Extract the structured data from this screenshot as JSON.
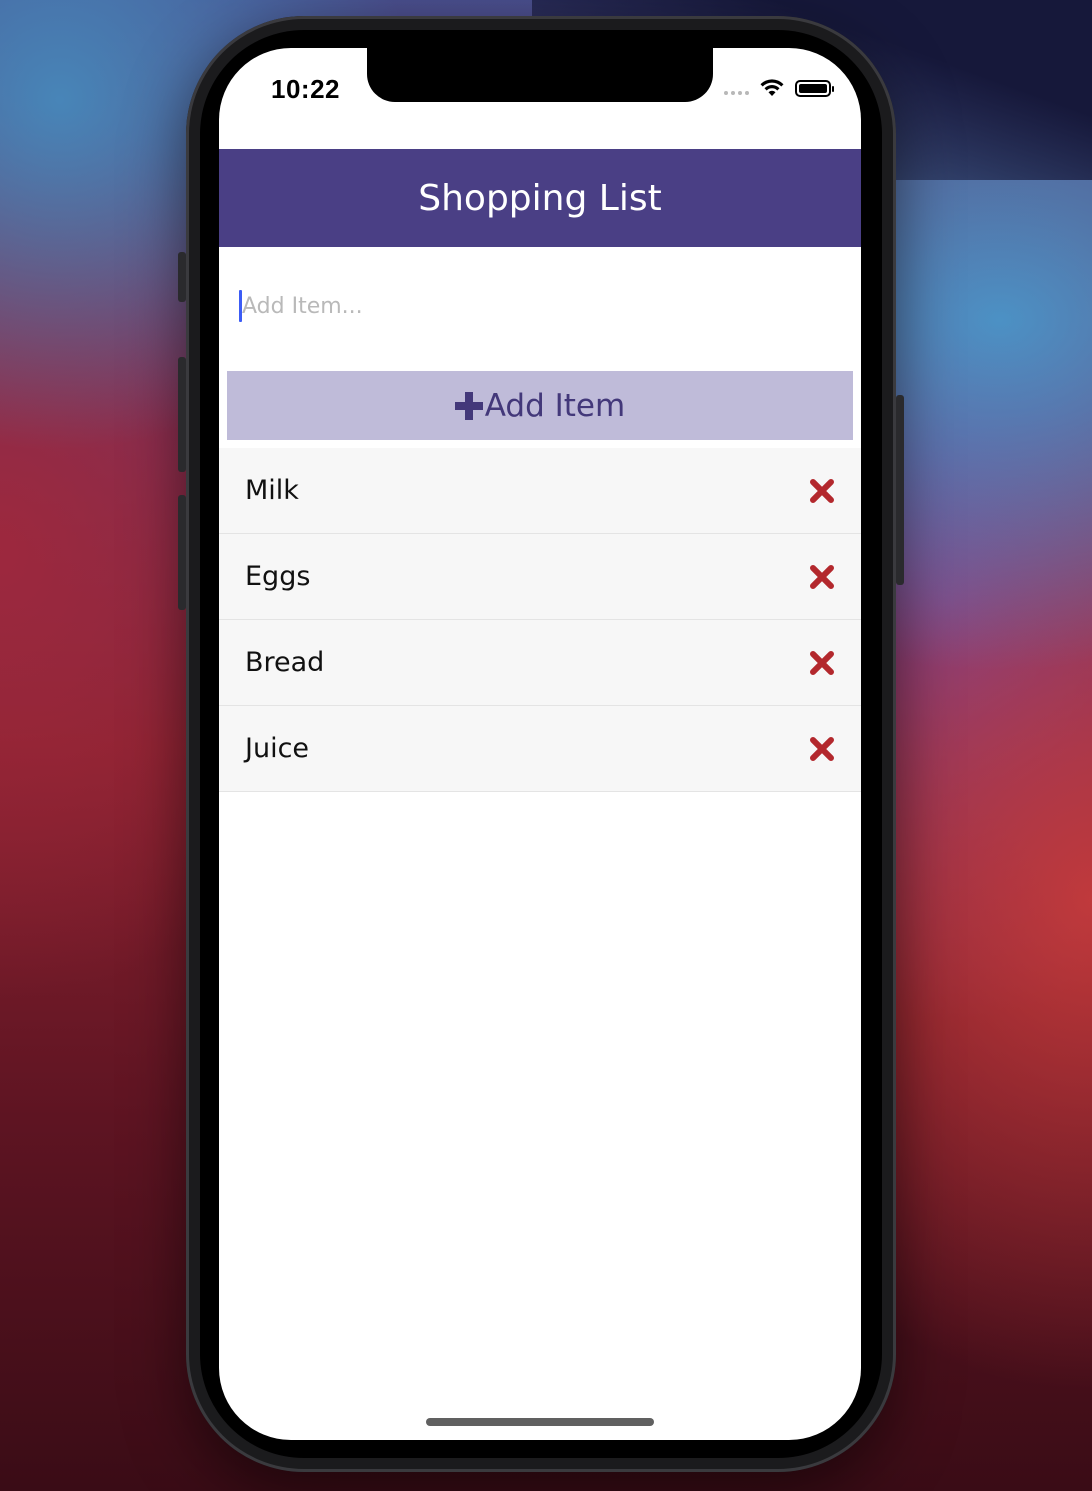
{
  "status_bar": {
    "time": "10:22"
  },
  "header": {
    "title": "Shopping List"
  },
  "input": {
    "placeholder": "Add Item...",
    "value": ""
  },
  "add_button": {
    "label": "Add Item",
    "icon": "plus-icon"
  },
  "items": [
    {
      "label": "Milk",
      "delete_icon": "close-icon"
    },
    {
      "label": "Eggs",
      "delete_icon": "close-icon"
    },
    {
      "label": "Bread",
      "delete_icon": "close-icon"
    },
    {
      "label": "Juice",
      "delete_icon": "close-icon"
    }
  ],
  "colors": {
    "header_bg": "#4a3f85",
    "button_bg": "#bfbbd9",
    "button_text": "#43387a",
    "delete_icon": "#b3282d",
    "list_bg": "#f7f7f7"
  }
}
